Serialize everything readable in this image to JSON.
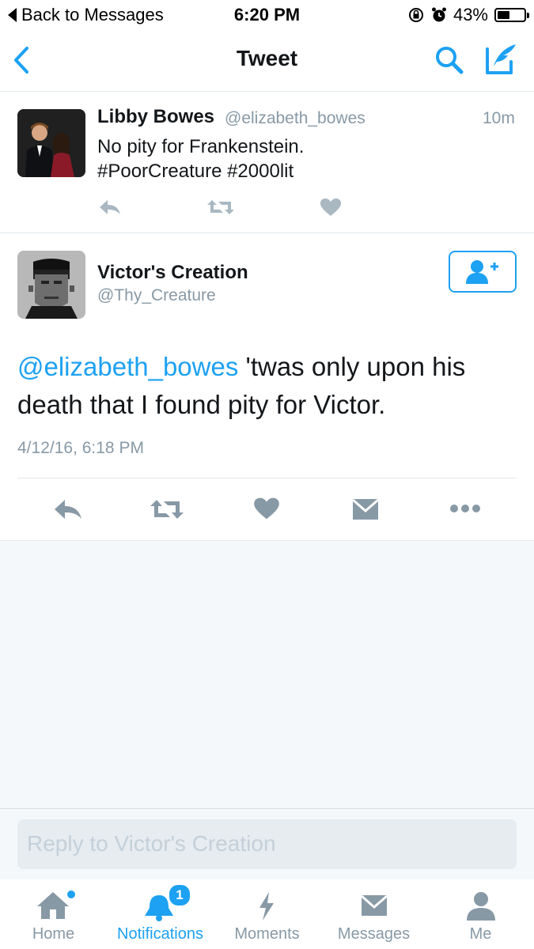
{
  "status_bar": {
    "back_label": "Back to Messages",
    "time": "6:20 PM",
    "battery": "43%"
  },
  "nav": {
    "title": "Tweet",
    "back_icon": "chevron-left-icon",
    "search_icon": "search-icon",
    "compose_icon": "compose-icon"
  },
  "parent_tweet": {
    "name": "Libby Bowes",
    "handle": "@elizabeth_bowes",
    "time": "10m",
    "text_line1": "No pity for Frankenstein.",
    "text_line2": "#PoorCreature #2000lit"
  },
  "main_tweet": {
    "name": "Victor's Creation",
    "handle": "@Thy_Creature",
    "mention": "@elizabeth_bowes",
    "text_after_mention": " 'twas only upon his",
    "text_line2": "death that I found pity for Victor.",
    "timestamp": "4/12/16, 6:18 PM"
  },
  "reply": {
    "placeholder": "Reply to Victor's Creation"
  },
  "tabs": [
    {
      "label": "Home",
      "icon": "home-icon"
    },
    {
      "label": "Notifications",
      "icon": "bell-icon",
      "badge": "1"
    },
    {
      "label": "Moments",
      "icon": "lightning-icon"
    },
    {
      "label": "Messages",
      "icon": "envelope-icon"
    },
    {
      "label": "Me",
      "icon": "person-icon"
    }
  ],
  "colors": {
    "accent": "#1da1f2",
    "muted": "#8899a6",
    "background": "#f5f8fa"
  }
}
